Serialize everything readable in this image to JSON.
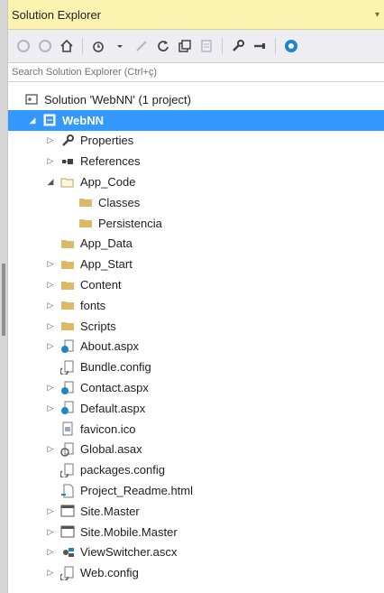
{
  "panel": {
    "title": "Solution Explorer",
    "pin_glyph": "▾",
    "search_placeholder": "Search Solution Explorer (Ctrl+ç)"
  },
  "toolbar": [
    {
      "name": "back-icon"
    },
    {
      "name": "forward-icon"
    },
    {
      "name": "home-icon"
    },
    {
      "sep": true
    },
    {
      "name": "pending-changes-icon"
    },
    {
      "name": "dropdown-arrow-icon"
    },
    {
      "name": "sync-icon"
    },
    {
      "name": "refresh-icon"
    },
    {
      "name": "collapse-all-icon"
    },
    {
      "name": "show-all-files-icon"
    },
    {
      "sep": true
    },
    {
      "name": "properties-icon"
    },
    {
      "name": "preview-icon"
    },
    {
      "sep": true
    },
    {
      "name": "team-explorer-icon"
    }
  ],
  "tree": [
    {
      "label": "Solution 'WebNN' (1 project)",
      "indent": 0,
      "arrow": "",
      "icon": "solution-icon"
    },
    {
      "label": "WebNN",
      "indent": 1,
      "arrow": "◢",
      "icon": "project-icon",
      "selected": true,
      "bold": true
    },
    {
      "label": "Properties",
      "indent": 2,
      "arrow": "▷",
      "icon": "wrench-icon"
    },
    {
      "label": "References",
      "indent": 2,
      "arrow": "▷",
      "icon": "references-icon"
    },
    {
      "label": "App_Code",
      "indent": 2,
      "arrow": "◢",
      "icon": "folder-open-icon"
    },
    {
      "label": "Classes",
      "indent": 3,
      "arrow": "",
      "icon": "folder-icon"
    },
    {
      "label": "Persistencia",
      "indent": 3,
      "arrow": "",
      "icon": "folder-icon"
    },
    {
      "label": "App_Data",
      "indent": 2,
      "arrow": "",
      "icon": "folder-icon"
    },
    {
      "label": "App_Start",
      "indent": 2,
      "arrow": "▷",
      "icon": "folder-icon"
    },
    {
      "label": "Content",
      "indent": 2,
      "arrow": "▷",
      "icon": "folder-icon"
    },
    {
      "label": "fonts",
      "indent": 2,
      "arrow": "▷",
      "icon": "folder-icon"
    },
    {
      "label": "Scripts",
      "indent": 2,
      "arrow": "▷",
      "icon": "folder-icon"
    },
    {
      "label": "About.aspx",
      "indent": 2,
      "arrow": "▷",
      "icon": "aspx-file-icon"
    },
    {
      "label": "Bundle.config",
      "indent": 2,
      "arrow": "",
      "icon": "config-file-icon"
    },
    {
      "label": "Contact.aspx",
      "indent": 2,
      "arrow": "▷",
      "icon": "aspx-file-icon"
    },
    {
      "label": "Default.aspx",
      "indent": 2,
      "arrow": "▷",
      "icon": "aspx-file-icon"
    },
    {
      "label": "favicon.ico",
      "indent": 2,
      "arrow": "",
      "icon": "image-file-icon"
    },
    {
      "label": "Global.asax",
      "indent": 2,
      "arrow": "▷",
      "icon": "asax-file-icon"
    },
    {
      "label": "packages.config",
      "indent": 2,
      "arrow": "",
      "icon": "config-file-icon"
    },
    {
      "label": "Project_Readme.html",
      "indent": 2,
      "arrow": "",
      "icon": "html-file-icon"
    },
    {
      "label": "Site.Master",
      "indent": 2,
      "arrow": "▷",
      "icon": "master-file-icon"
    },
    {
      "label": "Site.Mobile.Master",
      "indent": 2,
      "arrow": "▷",
      "icon": "master-file-icon"
    },
    {
      "label": "ViewSwitcher.ascx",
      "indent": 2,
      "arrow": "▷",
      "icon": "user-control-icon"
    },
    {
      "label": "Web.config",
      "indent": 2,
      "arrow": "▷",
      "icon": "config-file-icon"
    }
  ]
}
